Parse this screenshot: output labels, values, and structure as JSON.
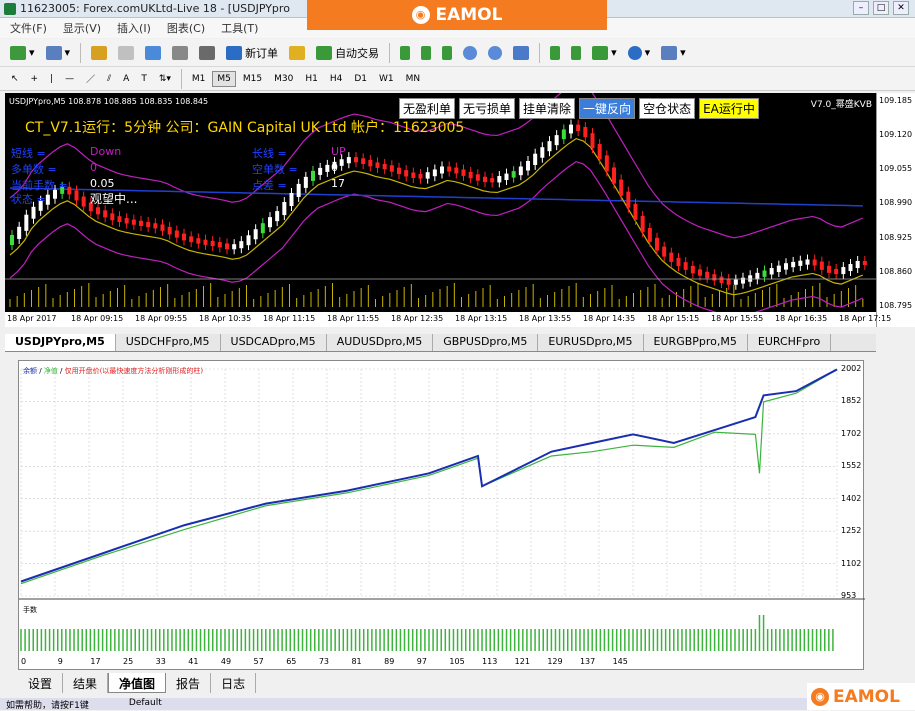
{
  "window": {
    "title": "11623005: Forex.comUKLtd-Live 18 - [USDJPYpro"
  },
  "banner": {
    "text": "EAMOL"
  },
  "menu": {
    "items": [
      "文件(F)",
      "显示(V)",
      "插入(I)",
      "图表(C)",
      "工具(T)"
    ]
  },
  "toolbar": {
    "new_order": "新订单",
    "auto_trade": "自动交易"
  },
  "timeframes": [
    "M1",
    "M5",
    "M15",
    "M30",
    "H1",
    "H4",
    "D1",
    "W1",
    "MN"
  ],
  "active_timeframe": "M5",
  "chart": {
    "symbol_line": "USDJPYpro,M5  108.878 108.885 108.835 108.845",
    "info_line": "CT_V7.1运行：5分钟 公司：GAIN Capital UK Ltd 帐户：11623005",
    "buttons": [
      "无盈利单",
      "无亏损单",
      "挂单清除",
      "一键反向",
      "空仓状态",
      "EA运行中"
    ],
    "version": "V7.0_幂盛KVB",
    "left_block": {
      "l1": "短线 =",
      "l1v": "Down",
      "l2": "多单数 =",
      "l2v": "0",
      "l3": "当前手数 =",
      "l3v": "0.05",
      "l4": "状态 =",
      "l4v": "观望中..."
    },
    "right_block": {
      "r1": "长线 =",
      "r1v": "UP",
      "r2": "空单数 =",
      "r2v": "0",
      "r3": "点差 =",
      "r3v": "17"
    },
    "price_ticks": [
      "109.185",
      "109.120",
      "109.055",
      "108.990",
      "108.925",
      "108.860",
      "108.795"
    ],
    "time_ticks": [
      "18 Apr 2017",
      "18 Apr 09:15",
      "18 Apr 09:55",
      "18 Apr 10:35",
      "18 Apr 11:15",
      "18 Apr 11:55",
      "18 Apr 12:35",
      "18 Apr 13:15",
      "18 Apr 13:55",
      "18 Apr 14:35",
      "18 Apr 15:15",
      "18 Apr 15:55",
      "18 Apr 16:35",
      "18 Apr 17:15"
    ],
    "colors": {
      "bull": "#ffffff",
      "bear": "#ff2020",
      "bull2": "#3cdc3c",
      "ma": "#c8b400",
      "ma2": "#2040d0",
      "band": "#c020c0"
    }
  },
  "symbol_tabs": [
    "USDJPYpro,M5",
    "USDCHFpro,M5",
    "USDCADpro,M5",
    "AUDUSDpro,M5",
    "GBPUSDpro,M5",
    "EURUSDpro,M5",
    "EURGBPpro,M5",
    "EURCHFpro"
  ],
  "report": {
    "legend": {
      "balance": "余额",
      "equity": "净值",
      "note": "仅用开盘价(以最快速度方法分析刚形成的柱)"
    },
    "volume_label": "手数",
    "y_ticks": [
      "2002",
      "1852",
      "1702",
      "1552",
      "1402",
      "1252",
      "1102",
      "953"
    ],
    "x_ticks": [
      "0",
      "9",
      "17",
      "25",
      "33",
      "41",
      "49",
      "57",
      "65",
      "73",
      "81",
      "89",
      "97",
      "105",
      "113",
      "121",
      "129",
      "137",
      "145"
    ]
  },
  "chart_data": {
    "type": "line",
    "ylim": [
      953,
      2002
    ],
    "series": [
      {
        "name": "余额",
        "x": [
          0,
          20,
          40,
          60,
          80,
          100,
          112,
          113,
          130,
          140,
          150,
          160,
          170,
          180,
          182,
          190,
          200
        ],
        "values": [
          1020,
          1150,
          1280,
          1380,
          1440,
          1520,
          1600,
          1460,
          1620,
          1660,
          1700,
          1660,
          1720,
          1780,
          1880,
          1900,
          2000
        ]
      },
      {
        "name": "净值",
        "x": [
          0,
          20,
          40,
          60,
          80,
          100,
          112,
          113,
          130,
          140,
          150,
          160,
          170,
          180,
          181,
          182,
          190,
          200
        ],
        "values": [
          1010,
          1140,
          1260,
          1370,
          1430,
          1510,
          1590,
          1460,
          1600,
          1620,
          1650,
          1640,
          1710,
          1700,
          1520,
          1850,
          1890,
          2000
        ]
      }
    ]
  },
  "bottom_tabs": [
    "设置",
    "结果",
    "净值图",
    "报告",
    "日志"
  ],
  "active_bottom_tab": "净值图",
  "status": {
    "left": "如需帮助，请按F1键",
    "mid": "Default"
  },
  "watermark": "EAMOL"
}
